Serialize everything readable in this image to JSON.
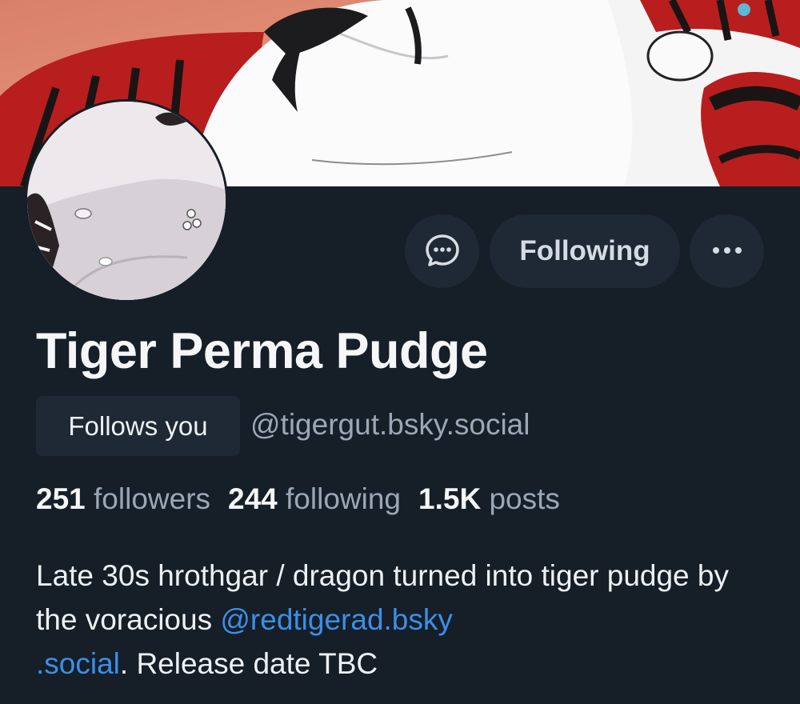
{
  "profile": {
    "display_name": "Tiger Perma Pudge",
    "follows_you_label": "Follows you",
    "handle": "@tigergut.bsky.social",
    "stats": {
      "followers_count": "251",
      "followers_label": "followers",
      "following_count": "244",
      "following_label": "following",
      "posts_count": "1.5K",
      "posts_label": "posts"
    },
    "bio": {
      "text_before": "Late 30s hrothgar / dragon turned into tiger pudge by the voracious ",
      "mention_line1": "@redtigerad.bsky",
      "mention_line2": ".social",
      "text_after": ". Release date TBC"
    }
  },
  "actions": {
    "message_icon": "chat-bubble-icon",
    "following_label": "Following",
    "more_icon": "ellipsis-icon"
  },
  "colors": {
    "background": "#161e27",
    "button_bg": "#1e2935",
    "muted_text": "#9aa7b6",
    "link": "#3b8fe8"
  }
}
